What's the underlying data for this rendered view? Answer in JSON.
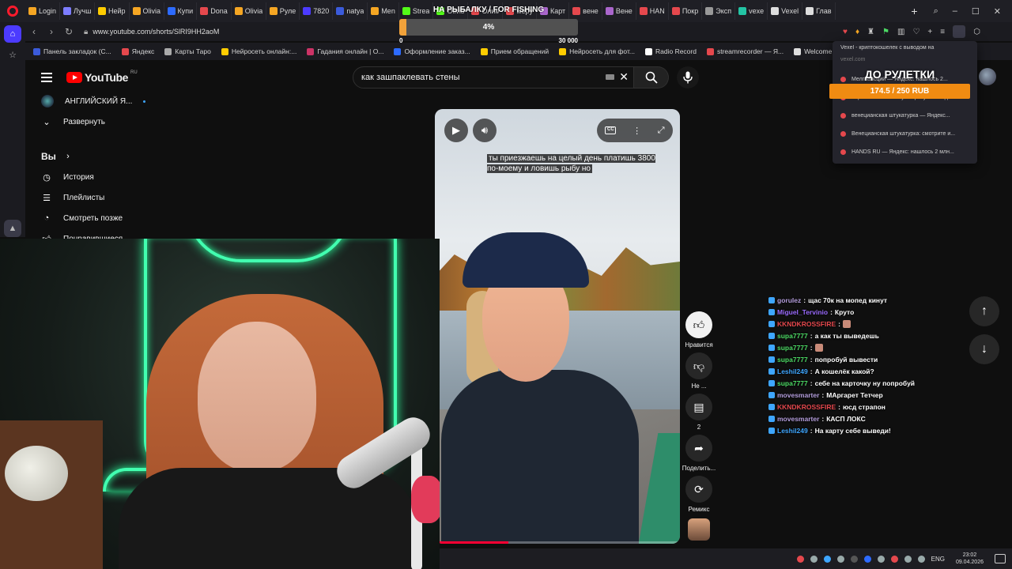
{
  "browser": {
    "tabs": [
      {
        "label": "Login",
        "color": "#f5a623"
      },
      {
        "label": "Лучш",
        "color": "#7d7dff"
      },
      {
        "label": "Нейр",
        "color": "#ffcc00"
      },
      {
        "label": "Olivia",
        "color": "#f5a623"
      },
      {
        "label": "Купи",
        "color": "#2d6bff"
      },
      {
        "label": "Dona",
        "color": "#e5484d"
      },
      {
        "label": "Olivia",
        "color": "#f5a623"
      },
      {
        "label": "Руле",
        "color": "#f5a623"
      },
      {
        "label": "7820",
        "color": "#4c3bff"
      },
      {
        "label": "natya",
        "color": "#3b5bdb"
      },
      {
        "label": "Men",
        "color": "#f5a623"
      },
      {
        "label": "Strea",
        "color": "#53fc18"
      },
      {
        "label": "Olivia",
        "color": "#53fc18"
      },
      {
        "label": "Олимп",
        "color": "#e5484d"
      },
      {
        "label": "меру",
        "color": "#e5484d"
      },
      {
        "label": "Карт",
        "color": "#aa66cc"
      },
      {
        "label": "вене",
        "color": "#e5484d"
      },
      {
        "label": "Вене",
        "color": "#aa66cc"
      },
      {
        "label": "HAN",
        "color": "#e5484d"
      },
      {
        "label": "Покр",
        "color": "#e5484d"
      },
      {
        "label": "Эксп",
        "color": "#999999"
      },
      {
        "label": "vexe",
        "color": "#23c4a4"
      },
      {
        "label": "Vexel",
        "color": "#dddddd"
      },
      {
        "label": "Глав",
        "color": "#dddddd"
      }
    ],
    "url": "www.youtube.com/shorts/SlRI9HH2aoM",
    "bookmarks": [
      {
        "label": "Панель закладок (С...",
        "color": "#3b5bdb"
      },
      {
        "label": "Яндекс",
        "color": "#e5484d"
      },
      {
        "label": "Карты Таро",
        "color": "#aaaaaa"
      },
      {
        "label": "Нейросеть онлайн:...",
        "color": "#ffcc00"
      },
      {
        "label": "Гадания онлайн | О...",
        "color": "#cc3366"
      },
      {
        "label": "Оформление заказ...",
        "color": "#2d6bff"
      },
      {
        "label": "Прием обращений",
        "color": "#ffcc00"
      },
      {
        "label": "Нейросеть для фот...",
        "color": "#ffcc00"
      },
      {
        "label": "Radio Record",
        "color": "#ffffff"
      },
      {
        "label": "streamrecorder — Я...",
        "color": "#e5484d"
      },
      {
        "label": "Welcome back - Str...",
        "color": "#dddddd"
      }
    ]
  },
  "overlay": {
    "fishing_title": "НА РЫБАЛКУ / FOR FISHING",
    "fishing_percent_text": "4%",
    "fishing_progress": 0.04,
    "fishing_min": "0",
    "fishing_max": "30 000",
    "roulette_title": "ДО РУЛЕТКИ",
    "roulette_amount": "174.5 / 250 RUB"
  },
  "ext_dropdown": {
    "header": "Vexel - криптокошелек с выводом на",
    "sub": "vexel.com",
    "items": [
      "Мелгиансций — Яндекс: нашлось 2...",
      "Картинки на вашему запросу не найд...",
      "венецианская штукатурка — Яндекс...",
      "Венецианская штукатурка: смотрите и...",
      "HANDS RU — Яндекс: нашлось 2 млн..."
    ]
  },
  "youtube": {
    "logo_text": "YouTube",
    "region": "RU",
    "search_value": "как зашпаклевать стены",
    "guide": {
      "channel": "АНГЛИЙСКИЙ Я...",
      "expand": "Развернуть",
      "you": "Вы",
      "history": "История",
      "playlists": "Плейлисты",
      "watch_later": "Смотреть позже",
      "liked": "Понравившиеся"
    },
    "player": {
      "subtitle": "ты приезжаешь на целый день платишь 3800 по-моему и ловишь рыбу но",
      "cc": "CC",
      "progress": 0.3
    },
    "actions": {
      "like": "Нравится",
      "dislike": "Не ...",
      "comments": "2",
      "share": "Поделить...",
      "remix": "Ремикс"
    }
  },
  "chat": [
    {
      "user": "gorulez",
      "color": "#b39ddb",
      "msg": "щас 70к на мопед кинут"
    },
    {
      "user": "Miguel_Tervinio",
      "color": "#9b6bff",
      "msg": "Круто"
    },
    {
      "user": "KKNDKROSSFIRE",
      "color": "#e5484d",
      "msg": ""
    },
    {
      "user": "supa7777",
      "color": "#4cd964",
      "msg": "а как ты выведешь"
    },
    {
      "user": "supa7777",
      "color": "#4cd964",
      "msg": ""
    },
    {
      "user": "supa7777",
      "color": "#4cd964",
      "msg": "попробуй вывести"
    },
    {
      "user": "Leshil249",
      "color": "#3ea6ff",
      "msg": "А кошелёк какой?"
    },
    {
      "user": "supa7777",
      "color": "#4cd964",
      "msg": "себе на карточку ну попробуй"
    },
    {
      "user": "movesmarter",
      "color": "#b39ddb",
      "msg": "МАргарет Тетчер"
    },
    {
      "user": "KKNDKROSSFIRE",
      "color": "#e5484d",
      "msg": "юсд страпон"
    },
    {
      "user": "movesmarter",
      "color": "#b39ddb",
      "msg": "КАСП ЛОКС"
    },
    {
      "user": "Leshil249",
      "color": "#3ea6ff",
      "msg": "На карту себе выведи!"
    }
  ],
  "taskbar": {
    "lang": "ENG",
    "time": "23:02",
    "date": "09.04.2026"
  }
}
